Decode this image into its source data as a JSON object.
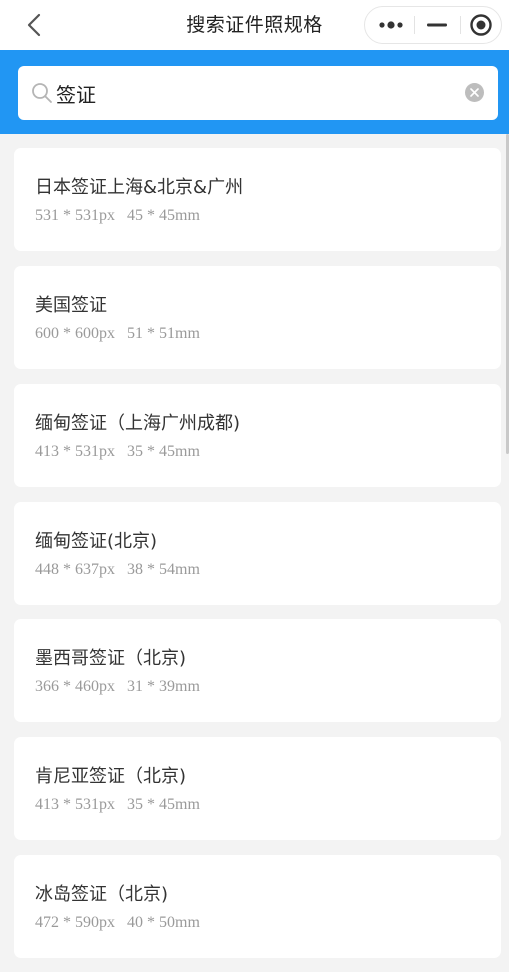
{
  "header": {
    "title": "搜索证件照规格"
  },
  "icons": {
    "back": "chevron-left-icon",
    "more": "more-dots-icon",
    "minimize": "minimize-icon",
    "close": "target-close-icon",
    "search": "search-icon",
    "clear": "clear-icon"
  },
  "colors": {
    "accent": "#2196f3",
    "card_bg": "#ffffff",
    "page_bg": "#f3f3f3"
  },
  "search": {
    "value": "签证",
    "placeholder": ""
  },
  "results": [
    {
      "name": "日本签证上海&北京&广州",
      "px": "531 * 531px",
      "mm": "45 * 45mm"
    },
    {
      "name": "美国签证",
      "px": "600 * 600px",
      "mm": "51 * 51mm"
    },
    {
      "name": "缅甸签证（上海广州成都)",
      "px": "413 * 531px",
      "mm": "35 * 45mm"
    },
    {
      "name": "缅甸签证(北京)",
      "px": "448 * 637px",
      "mm": "38 * 54mm"
    },
    {
      "name": "墨西哥签证（北京)",
      "px": "366 * 460px",
      "mm": "31 * 39mm"
    },
    {
      "name": "肯尼亚签证（北京)",
      "px": "413 * 531px",
      "mm": "35 * 45mm"
    },
    {
      "name": "冰岛签证（北京)",
      "px": "472 * 590px",
      "mm": "40 * 50mm"
    }
  ]
}
